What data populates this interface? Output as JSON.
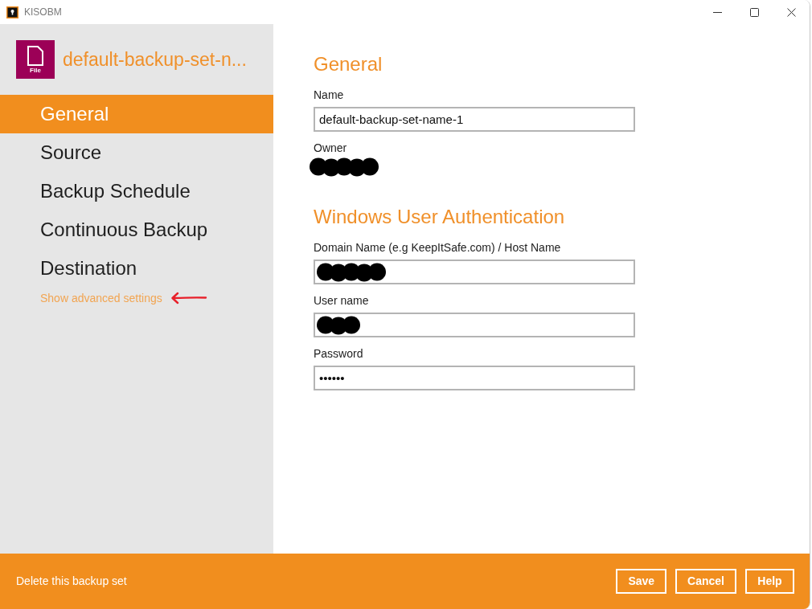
{
  "window": {
    "title": "KISOBM"
  },
  "sidebar": {
    "backup_set": {
      "type_label": "File",
      "name": "default-backup-set-n..."
    },
    "items": [
      {
        "label": "General",
        "selected": true
      },
      {
        "label": "Source",
        "selected": false
      },
      {
        "label": "Backup Schedule",
        "selected": false
      },
      {
        "label": "Continuous Backup",
        "selected": false
      },
      {
        "label": "Destination",
        "selected": false
      }
    ],
    "advanced_link": "Show advanced settings"
  },
  "content": {
    "sections": [
      {
        "heading": "General",
        "fields": [
          {
            "kind": "input",
            "label": "Name",
            "value": "default-backup-set-name-1",
            "redacted": false
          },
          {
            "kind": "readonly",
            "label": "Owner",
            "redacted": true
          }
        ]
      },
      {
        "heading": "Windows User Authentication",
        "fields": [
          {
            "kind": "input",
            "label": "Domain Name (e.g KeepItSafe.com) / Host Name",
            "redacted": true
          },
          {
            "kind": "input",
            "label": "User name",
            "redacted": true
          },
          {
            "kind": "input",
            "label": "Password",
            "value": "••••••",
            "redacted": false
          }
        ]
      }
    ]
  },
  "footer": {
    "delete_link": "Delete this backup set",
    "buttons": [
      "Save",
      "Cancel",
      "Help"
    ]
  }
}
